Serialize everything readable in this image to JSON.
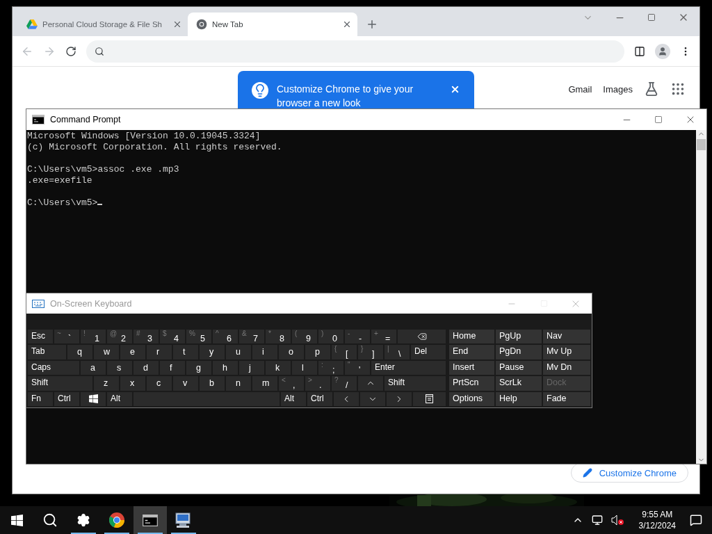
{
  "browser": {
    "tabs": [
      {
        "title": "Personal Cloud Storage & File Sh",
        "selected": false
      },
      {
        "title": "New Tab",
        "selected": true
      }
    ],
    "toolbar": {
      "back_disabled": true,
      "forward_disabled": true
    },
    "promo": {
      "text": "Customize Chrome to give your browser a new look"
    },
    "links": [
      "Gmail",
      "Images"
    ],
    "customize_button": "Customize Chrome"
  },
  "command_prompt": {
    "title": "Command Prompt",
    "cursor_visible": true,
    "blocks": [
      [
        "Microsoft Windows [Version 10.0.19045.3324]",
        "(c) Microsoft Corporation. All rights reserved."
      ],
      [
        "C:\\Users\\vm5>assoc .exe .mp3",
        ".exe=exefile"
      ],
      [
        "C:\\Users\\vm5>"
      ]
    ]
  },
  "keyboard": {
    "title": "On-Screen Keyboard",
    "rows": [
      [
        {
          "kind": "text",
          "label": "Esc"
        },
        {
          "kind": "char",
          "shift": "~",
          "label": "`"
        },
        {
          "kind": "char",
          "shift": "!",
          "label": "1"
        },
        {
          "kind": "char",
          "shift": "@",
          "label": "2"
        },
        {
          "kind": "char",
          "shift": "#",
          "label": "3"
        },
        {
          "kind": "char",
          "shift": "$",
          "label": "4"
        },
        {
          "kind": "char",
          "shift": "%",
          "label": "5"
        },
        {
          "kind": "char",
          "shift": "^",
          "label": "6"
        },
        {
          "kind": "char",
          "shift": "&",
          "label": "7"
        },
        {
          "kind": "char",
          "shift": "*",
          "label": "8"
        },
        {
          "kind": "char",
          "shift": "(",
          "label": "9"
        },
        {
          "kind": "char",
          "shift": ")",
          "label": "0"
        },
        {
          "kind": "char",
          "shift": "-",
          "label": "-"
        },
        {
          "kind": "char",
          "shift": "+",
          "label": "="
        },
        {
          "kind": "backspace"
        }
      ],
      [
        {
          "kind": "tab",
          "label": "Tab"
        },
        {
          "kind": "char",
          "label": "q"
        },
        {
          "kind": "char",
          "label": "w"
        },
        {
          "kind": "char",
          "label": "e"
        },
        {
          "kind": "char",
          "label": "r"
        },
        {
          "kind": "char",
          "label": "t"
        },
        {
          "kind": "char",
          "label": "y"
        },
        {
          "kind": "char",
          "label": "u"
        },
        {
          "kind": "char",
          "label": "i"
        },
        {
          "kind": "char",
          "label": "o"
        },
        {
          "kind": "char",
          "label": "p"
        },
        {
          "kind": "char",
          "shift": "{",
          "label": "["
        },
        {
          "kind": "char",
          "shift": "}",
          "label": "]"
        },
        {
          "kind": "char",
          "shift": "|",
          "label": "\\"
        },
        {
          "kind": "fill",
          "label": "Del"
        }
      ],
      [
        {
          "kind": "caps",
          "label": "Caps"
        },
        {
          "kind": "char",
          "label": "a"
        },
        {
          "kind": "char",
          "label": "s"
        },
        {
          "kind": "char",
          "label": "d"
        },
        {
          "kind": "char",
          "label": "f"
        },
        {
          "kind": "char",
          "label": "g"
        },
        {
          "kind": "char",
          "label": "h"
        },
        {
          "kind": "char",
          "label": "j"
        },
        {
          "kind": "char",
          "label": "k"
        },
        {
          "kind": "char",
          "label": "l"
        },
        {
          "kind": "char",
          "shift": ":",
          "label": ";"
        },
        {
          "kind": "char",
          "shift": "\"",
          "label": "'"
        },
        {
          "kind": "fill",
          "label": "Enter"
        }
      ],
      [
        {
          "kind": "shift",
          "label": "Shift"
        },
        {
          "kind": "char",
          "label": "z"
        },
        {
          "kind": "char",
          "label": "x"
        },
        {
          "kind": "char",
          "label": "c"
        },
        {
          "kind": "char",
          "label": "v"
        },
        {
          "kind": "char",
          "label": "b"
        },
        {
          "kind": "char",
          "label": "n"
        },
        {
          "kind": "char",
          "label": "m"
        },
        {
          "kind": "char",
          "shift": "<",
          "label": ","
        },
        {
          "kind": "char",
          "shift": ">",
          "label": "."
        },
        {
          "kind": "char",
          "shift": "?",
          "label": "/"
        },
        {
          "kind": "up"
        },
        {
          "kind": "fill",
          "label": "Shift"
        }
      ],
      [
        {
          "kind": "text",
          "label": "Fn"
        },
        {
          "kind": "text",
          "label": "Ctrl"
        },
        {
          "kind": "win"
        },
        {
          "kind": "text",
          "label": "Alt"
        },
        {
          "kind": "space"
        },
        {
          "kind": "text",
          "label": "Alt"
        },
        {
          "kind": "text",
          "label": "Ctrl"
        },
        {
          "kind": "left"
        },
        {
          "kind": "down"
        },
        {
          "kind": "right"
        },
        {
          "kind": "menu"
        }
      ]
    ],
    "nav_keys": [
      {
        "label": "Home",
        "disabled": false
      },
      {
        "label": "PgUp",
        "disabled": false
      },
      {
        "label": "Nav",
        "disabled": false
      },
      {
        "label": "End",
        "disabled": false
      },
      {
        "label": "PgDn",
        "disabled": false
      },
      {
        "label": "Mv Up",
        "disabled": false
      },
      {
        "label": "Insert",
        "disabled": false
      },
      {
        "label": "Pause",
        "disabled": false
      },
      {
        "label": "Mv Dn",
        "disabled": false
      },
      {
        "label": "PrtScn",
        "disabled": false
      },
      {
        "label": "ScrLk",
        "disabled": false
      },
      {
        "label": "Dock",
        "disabled": true
      },
      {
        "label": "Options",
        "disabled": false
      },
      {
        "label": "Help",
        "disabled": false
      },
      {
        "label": "Fade",
        "disabled": false
      }
    ]
  },
  "taskbar": {
    "items": [
      {
        "kind": "start",
        "running": false,
        "active": false
      },
      {
        "kind": "search",
        "running": false,
        "active": false
      },
      {
        "kind": "settings",
        "running": true,
        "active": false
      },
      {
        "kind": "chrome",
        "running": true,
        "active": false
      },
      {
        "kind": "console",
        "running": true,
        "active": true
      },
      {
        "kind": "remote",
        "running": true,
        "active": false
      }
    ],
    "time": "9:55 AM",
    "date": "3/12/2024"
  }
}
